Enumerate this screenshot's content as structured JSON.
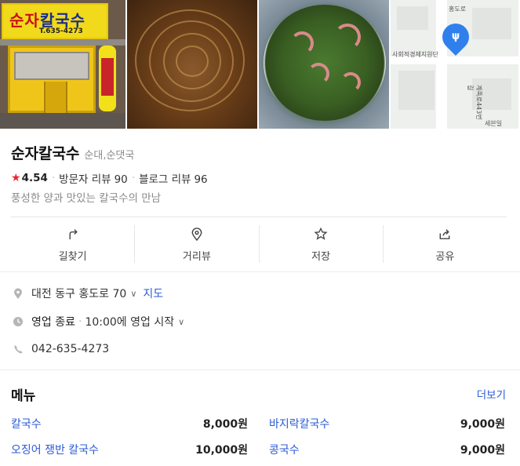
{
  "photos": {
    "storefront_sign_name_a": "순자",
    "storefront_sign_name_b": "칼국수",
    "storefront_sign_tel": "T.635-4273",
    "map_labels": [
      "홍도로",
      "사회적경제지원단",
      "계족로443번길",
      "세븐일"
    ]
  },
  "place": {
    "name": "순자칼국수",
    "category": "순대,순댓국",
    "rating": "4.54",
    "visitor_reviews_label": "방문자 리뷰",
    "visitor_reviews_count": "90",
    "blog_reviews_label": "블로그 리뷰",
    "blog_reviews_count": "96",
    "description": "풍성한 양과 맛있는 칼국수의 만남"
  },
  "actions": [
    {
      "label": "길찾기",
      "icon": "directions-icon"
    },
    {
      "label": "거리뷰",
      "icon": "location-pin-icon"
    },
    {
      "label": "저장",
      "icon": "star-icon"
    },
    {
      "label": "공유",
      "icon": "share-icon"
    }
  ],
  "info": {
    "address": "대전 동구 홍도로 70",
    "map_link": "지도",
    "status": "영업 종료",
    "hours": "10:00에 영업 시작",
    "phone": "042-635-4273"
  },
  "menu": {
    "title": "메뉴",
    "more_label": "더보기",
    "items": [
      {
        "name": "칼국수",
        "price": "8,000원"
      },
      {
        "name": "바지락칼국수",
        "price": "9,000원"
      },
      {
        "name": "오징어 쟁반 칼국수",
        "price": "10,000원"
      },
      {
        "name": "콩국수",
        "price": "9,000원"
      }
    ]
  },
  "colors": {
    "accent_blue": "#2a5bd7",
    "star_red": "#e8272f",
    "pin_blue": "#2f80ed"
  }
}
